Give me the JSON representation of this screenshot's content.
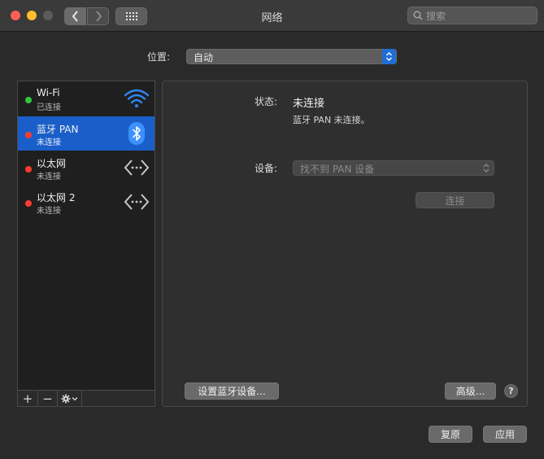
{
  "window": {
    "title": "网络",
    "search_placeholder": "搜索"
  },
  "location": {
    "label": "位置:",
    "value": "自动"
  },
  "services": [
    {
      "name": "Wi-Fi",
      "status": "已连接",
      "status_color": "#30c83a",
      "icon": "wifi-icon",
      "selected": false
    },
    {
      "name": "蓝牙 PAN",
      "status": "未连接",
      "status_color": "#ff3b30",
      "icon": "bluetooth-icon",
      "selected": true
    },
    {
      "name": "以太网",
      "status": "未连接",
      "status_color": "#ff3b30",
      "icon": "ethernet-icon",
      "selected": false
    },
    {
      "name": "以太网 2",
      "status": "未连接",
      "status_color": "#ff3b30",
      "icon": "ethernet-icon",
      "selected": false
    }
  ],
  "toolbar": {
    "add": "+",
    "remove": "−"
  },
  "detail": {
    "status_label": "状态:",
    "status_value": "未连接",
    "status_description": "蓝牙 PAN 未连接。",
    "device_label": "设备:",
    "device_value": "找不到 PAN 设备",
    "connect_label": "连接",
    "setup_label": "设置蓝牙设备...",
    "advanced_label": "高级...",
    "help_label": "?"
  },
  "footer": {
    "revert_label": "复原",
    "apply_label": "应用"
  },
  "colors": {
    "accent": "#1a5fc9",
    "connected": "#30c83a",
    "disconnected": "#ff3b30"
  }
}
